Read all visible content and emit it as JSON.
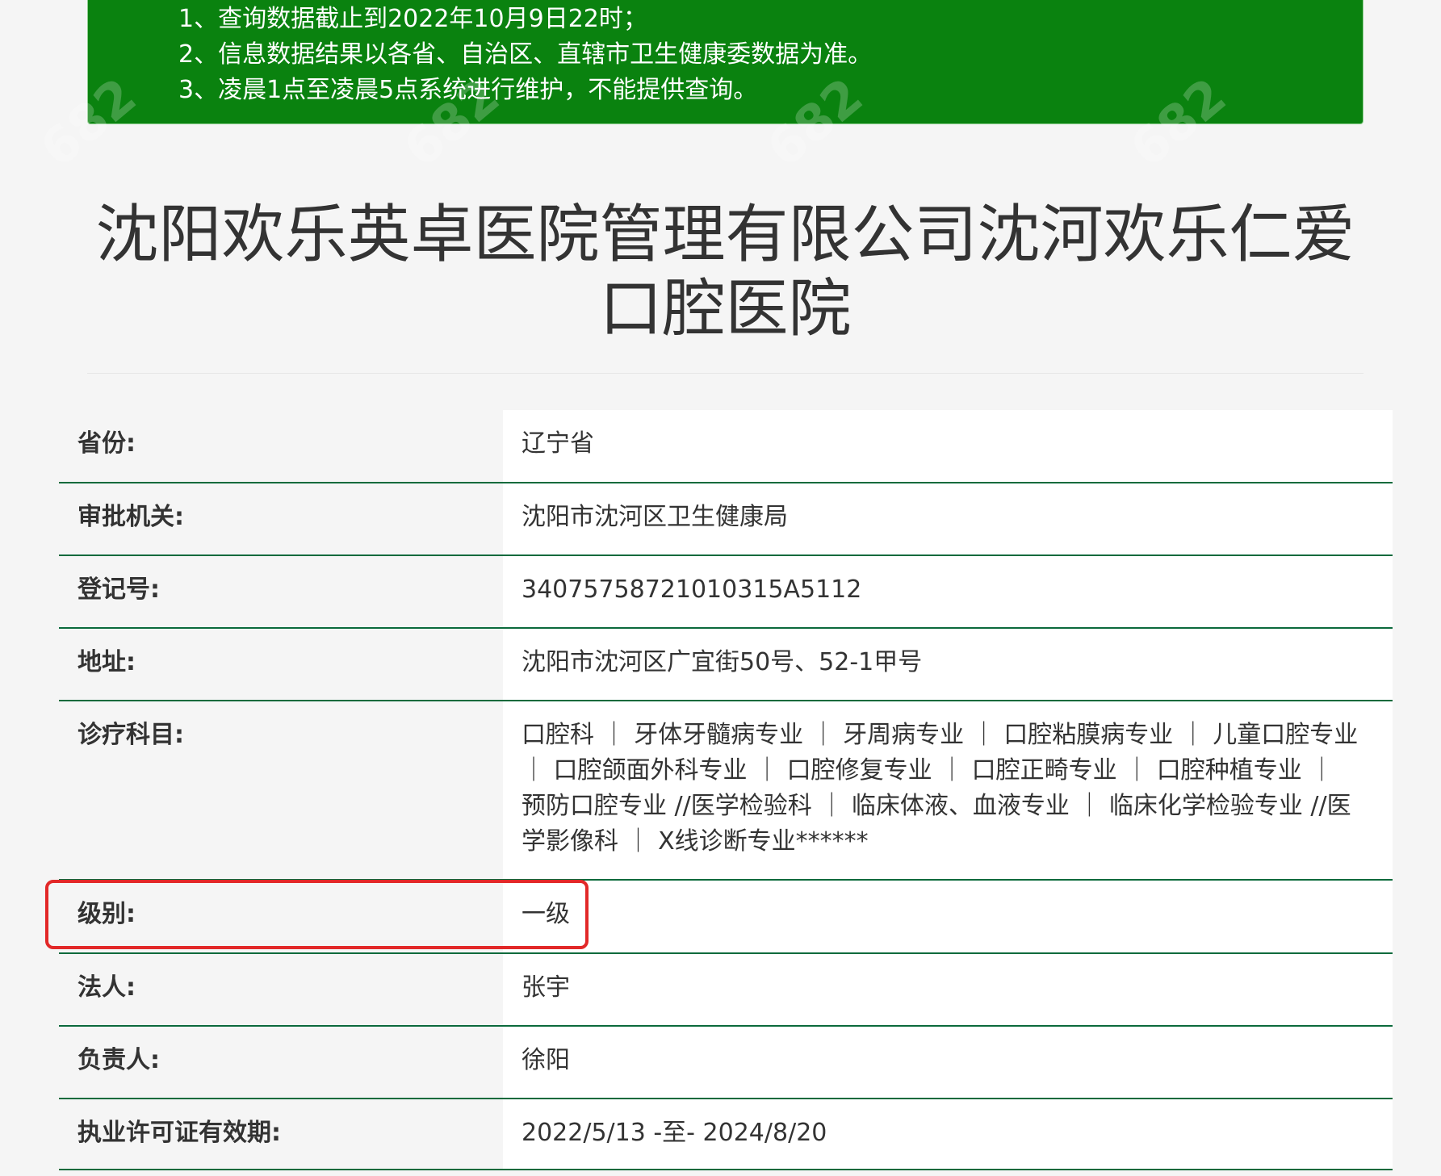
{
  "notice": {
    "lines": [
      "1、查询数据截止到2022年10月9日22时；",
      "2、信息数据结果以各省、自治区、直辖市卫生健康委数据为准。",
      "3、凌晨1点至凌晨5点系统进行维护，不能提供查询。"
    ],
    "watermark": "682"
  },
  "title": "沈阳欢乐英卓医院管理有限公司沈河欢乐仁爱口腔医院",
  "rows": [
    {
      "label": "省份:",
      "value": "辽宁省"
    },
    {
      "label": "审批机关:",
      "value": "沈阳市沈河区卫生健康局"
    },
    {
      "label": "登记号:",
      "value": "34075758721010315A5112"
    },
    {
      "label": "地址:",
      "value": "沈阳市沈河区广宜街50号、52-1甲号"
    },
    {
      "label": "诊疗科目:",
      "value": "口腔科 ｜ 牙体牙髓病专业 ｜ 牙周病专业 ｜ 口腔粘膜病专业 ｜ 儿童口腔专业 ｜ 口腔颌面外科专业 ｜ 口腔修复专业 ｜ 口腔正畸专业 ｜ 口腔种植专业 ｜ 预防口腔专业 //医学检验科 ｜ 临床体液、血液专业 ｜ 临床化学检验专业 //医学影像科 ｜ X线诊断专业******"
    },
    {
      "label": "级别:",
      "value": "一级"
    },
    {
      "label": "法人:",
      "value": "张宇"
    },
    {
      "label": "负责人:",
      "value": "徐阳"
    },
    {
      "label": "执业许可证有效期:",
      "value": "2022/5/13 -至- 2024/8/20"
    }
  ],
  "colors": {
    "notice_bg": "#0a820f",
    "row_border": "#0b6a3c",
    "highlight": "#e22828"
  }
}
